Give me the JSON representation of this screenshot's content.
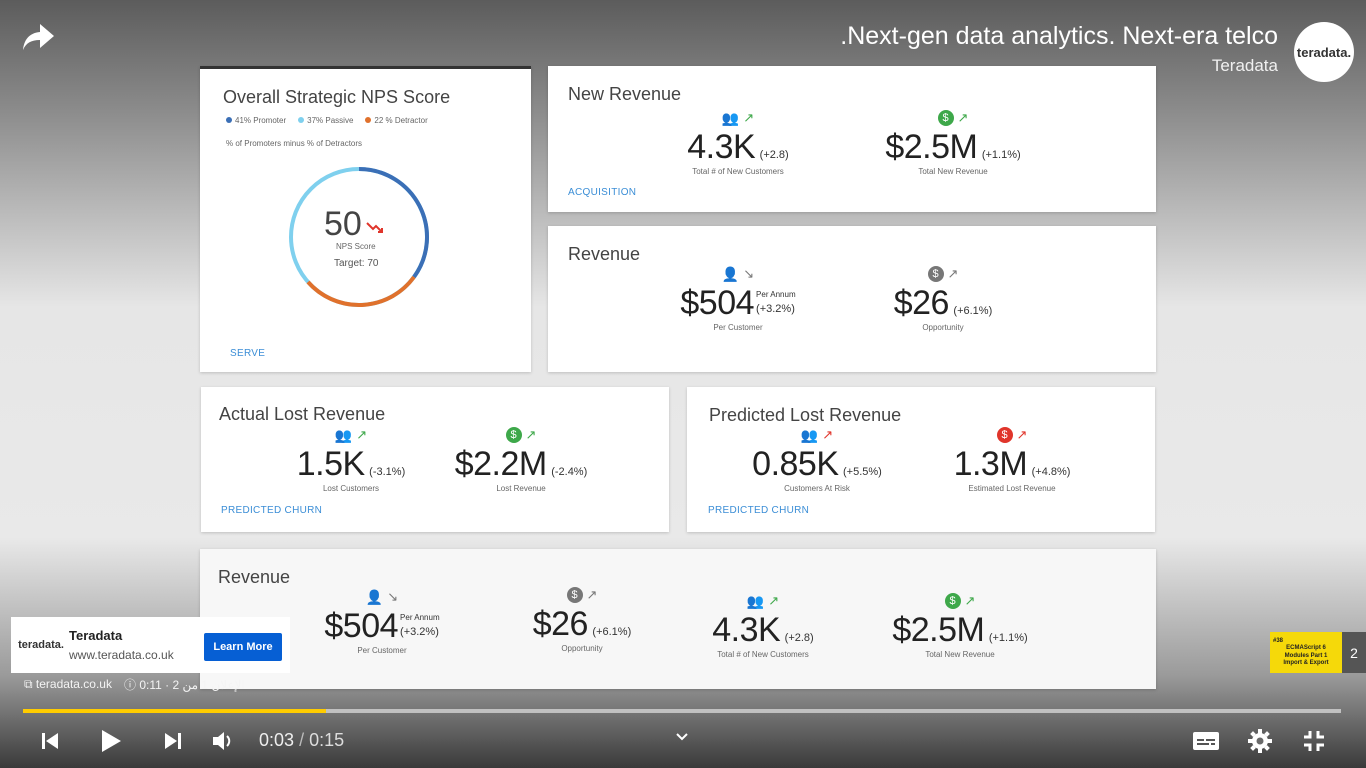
{
  "video": {
    "title": ".Next-gen data analytics. Next-era telco",
    "channel": "Teradata",
    "channel_logo": "teradata.",
    "time_current": "0:03",
    "time_separator": "/",
    "time_total": "0:15",
    "progress": 0.23
  },
  "dashboard": {
    "nps": {
      "title": "Overall Strategic NPS Score",
      "legend": [
        {
          "label": "41% Promoter",
          "color": "#3b6fb6"
        },
        {
          "label": "37% Passive",
          "color": "#7fd0ee"
        },
        {
          "label": "22 % Detractor",
          "color": "#e0712c"
        }
      ],
      "note": "% of Promoters minus % of Detractors",
      "value": "50",
      "value_label": "NPS Score",
      "target": "Target: 70",
      "link": "SERVE"
    },
    "new_revenue": {
      "title": "New Revenue",
      "m1_value": "4.3K",
      "m1_delta": "(+2.8)",
      "m1_label": "Total # of New Customers",
      "m2_value": "$2.5M",
      "m2_delta": "(+1.1%)",
      "m2_label": "Total New Revenue",
      "link": "ACQUISITION"
    },
    "revenue": {
      "title": "Revenue",
      "m1_value": "$504",
      "m1_unit": "Per Annum",
      "m1_delta": "(+3.2%)",
      "m1_label": "Per Customer",
      "m2_value": "$26",
      "m2_delta": "(+6.1%)",
      "m2_label": "Opportunity"
    },
    "actual_lost": {
      "title": "Actual Lost Revenue",
      "m1_value": "1.5K",
      "m1_delta": "(-3.1%)",
      "m1_label": "Lost Customers",
      "m2_value": "$2.2M",
      "m2_delta": "(-2.4%)",
      "m2_label": "Lost Revenue",
      "link": "PREDICTED CHURN"
    },
    "predicted_lost": {
      "title": "Predicted Lost Revenue",
      "m1_value": "0.85K",
      "m1_delta": "(+5.5%)",
      "m1_label": "Customers At Risk",
      "m2_value": "1.3M",
      "m2_delta": "(+4.8%)",
      "m2_label": "Estimated Lost Revenue",
      "link": "PREDICTED CHURN"
    },
    "revenue_bottom": {
      "title": "Revenue",
      "m1_value": "$504",
      "m1_unit": "Per Annum",
      "m1_delta": "(+3.2%)",
      "m1_label": "Per Customer",
      "m2_value": "$26",
      "m2_delta": "(+6.1%)",
      "m2_label": "Opportunity",
      "m3_value": "4.3K",
      "m3_delta": "(+2.8)",
      "m3_label": "Total # of New Customers",
      "m4_value": "$2.5M",
      "m4_delta": "(+1.1%)",
      "m4_label": "Total New Revenue"
    }
  },
  "ad": {
    "logo": "teradata.",
    "name": "Teradata",
    "url": "www.teradata.co.uk",
    "button": "Learn More",
    "domain": "teradata.co.uk",
    "info": "0:11 · الإعلان 1 من 2"
  },
  "up_next": {
    "thumb_line1": "#38",
    "thumb_line2": "ECMAScript 6",
    "thumb_line3": "Modules Part 1",
    "thumb_line4": "Import & Export",
    "count": "2"
  },
  "colors": {
    "green": "#3ea84a",
    "red": "#e0352b",
    "grey": "#777777",
    "accent": "#ffcc00",
    "blue": "#3b8ed6"
  }
}
